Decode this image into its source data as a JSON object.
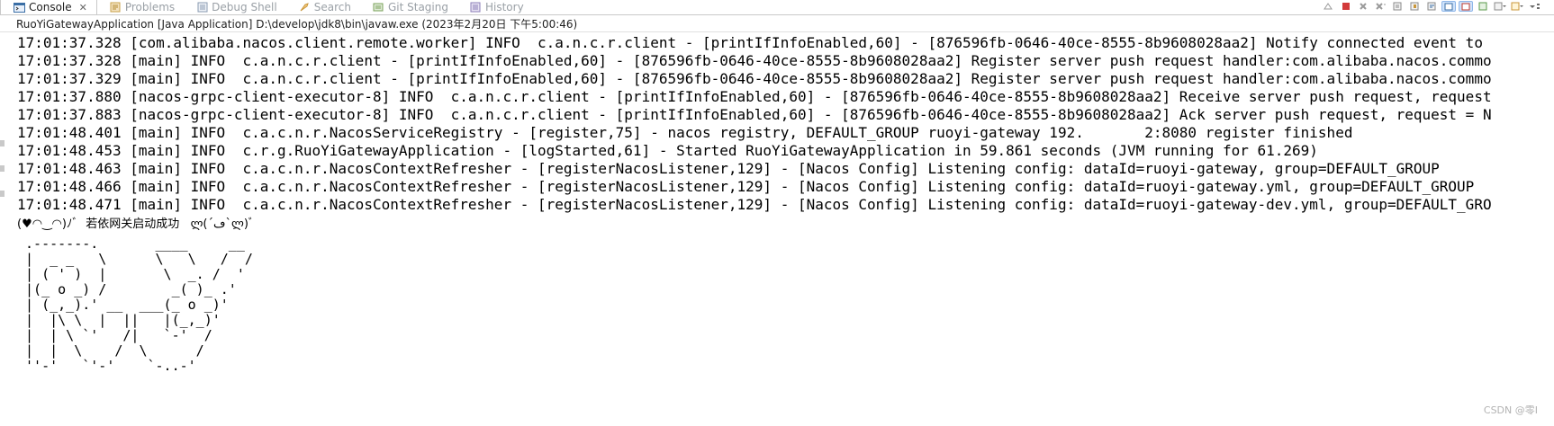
{
  "tabs": [
    {
      "label": "Console",
      "icon": "console-icon",
      "active": true
    },
    {
      "label": "Problems",
      "icon": "problems-icon",
      "active": false
    },
    {
      "label": "Debug Shell",
      "icon": "debug-shell-icon",
      "active": false
    },
    {
      "label": "Search",
      "icon": "search-icon",
      "active": false
    },
    {
      "label": "Git Staging",
      "icon": "git-staging-icon",
      "active": false
    },
    {
      "label": "History",
      "icon": "history-icon",
      "active": false
    }
  ],
  "close_glyph": "✕",
  "toolbar_icons": [
    "terminate-all-icon",
    "terminate-icon",
    "remove-launch-icon",
    "remove-all-terminated-icon",
    "clear-console-icon",
    "scroll-lock-icon",
    "word-wrap-icon",
    "show-on-stdout-icon",
    "show-on-stderr-icon",
    "pin-console-icon",
    "display-selected-console-icon",
    "open-console-icon"
  ],
  "process_label": "RuoYiGatewayApplication [Java Application] D:\\develop\\jdk8\\bin\\javaw.exe  (2023年2月20日 下午5:00:46)",
  "log_lines": [
    "17:01:37.328 [com.alibaba.nacos.client.remote.worker] INFO  c.a.n.c.r.client - [printIfInfoEnabled,60] - [876596fb-0646-40ce-8555-8b9608028aa2] Notify connected event to",
    "17:01:37.328 [main] INFO  c.a.n.c.r.client - [printIfInfoEnabled,60] - [876596fb-0646-40ce-8555-8b9608028aa2] Register server push request handler:com.alibaba.nacos.commo",
    "17:01:37.329 [main] INFO  c.a.n.c.r.client - [printIfInfoEnabled,60] - [876596fb-0646-40ce-8555-8b9608028aa2] Register server push request handler:com.alibaba.nacos.commo",
    "17:01:37.880 [nacos-grpc-client-executor-8] INFO  c.a.n.c.r.client - [printIfInfoEnabled,60] - [876596fb-0646-40ce-8555-8b9608028aa2] Receive server push request, request",
    "17:01:37.883 [nacos-grpc-client-executor-8] INFO  c.a.n.c.r.client - [printIfInfoEnabled,60] - [876596fb-0646-40ce-8555-8b9608028aa2] Ack server push request, request = N",
    "17:01:48.401 [main] INFO  c.a.c.n.r.NacosServiceRegistry - [register,75] - nacos registry, DEFAULT_GROUP ruoyi-gateway 192.       2:8080 register finished",
    "17:01:48.453 [main] INFO  c.r.g.RuoYiGatewayApplication - [logStarted,61] - Started RuoYiGatewayApplication in 59.861 seconds (JVM running for 61.269)",
    "17:01:48.463 [main] INFO  c.a.c.n.r.NacosContextRefresher - [registerNacosListener,129] - [Nacos Config] Listening config: dataId=ruoyi-gateway, group=DEFAULT_GROUP",
    "17:01:48.466 [main] INFO  c.a.c.n.r.NacosContextRefresher - [registerNacosListener,129] - [Nacos Config] Listening config: dataId=ruoyi-gateway.yml, group=DEFAULT_GROUP",
    "17:01:48.471 [main] INFO  c.a.c.n.r.NacosContextRefresher - [registerNacosListener,129] - [Nacos Config] Listening config: dataId=ruoyi-gateway-dev.yml, group=DEFAULT_GRO"
  ],
  "startup_message": "(♥◠‿◠)ﾉﾞ  若依网关启动成功   ლ(´ڡ`ლ)ﾞ",
  "banner_lines": [
    " .-------.       ____     __",
    " |  _ _   \\      \\   \\   /  /",
    " | ( ' )  |       \\  _. /  '",
    " |(_ o _) /        _( )_ .'",
    " | (_,_).' __  ___(_ o _)'",
    " |  |\\ \\  |  ||   |(_,_)'",
    " |  | \\ `'   /|   `-'  /",
    " |  |  \\    /  \\      /",
    " ''-'   `'-'    `-..-'"
  ],
  "watermark": "CSDN @零I"
}
